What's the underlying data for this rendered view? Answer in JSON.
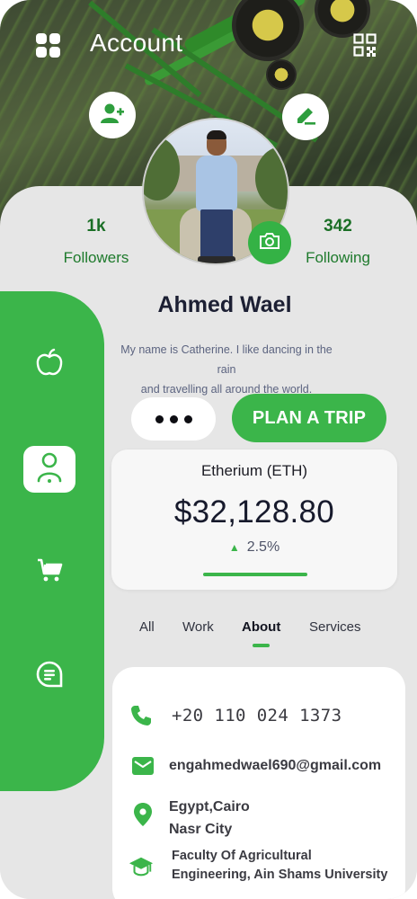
{
  "header": {
    "title": "Account",
    "menu_icon": "grid-icon",
    "qr_icon": "qr-code-icon"
  },
  "profile": {
    "name": "Ahmed Wael",
    "bio_line1": "My name is Catherine. I like dancing in the rain",
    "bio_line2": "and travelling all around the world.",
    "followers_count": "1k",
    "followers_label": "Followers",
    "following_count": "342",
    "following_label": "Following"
  },
  "actions": {
    "plan_trip_label": "PLAN A TRIP",
    "more_icon": "more-dots-icon",
    "add_friend_icon": "add-user-icon",
    "edit_icon": "edit-pencil-icon",
    "camera_icon": "camera-icon"
  },
  "sidebar": {
    "items": [
      {
        "icon": "apple-icon",
        "active": false
      },
      {
        "icon": "user-icon",
        "active": true
      },
      {
        "icon": "cart-icon",
        "active": false
      },
      {
        "icon": "chat-icon",
        "active": false
      }
    ]
  },
  "crypto": {
    "title": "Etherium (ETH)",
    "price": "$32,128.80",
    "change": "2.5%",
    "change_direction": "up"
  },
  "tabs": [
    {
      "label": "All",
      "active": false
    },
    {
      "label": "Work",
      "active": false
    },
    {
      "label": "About",
      "active": true
    },
    {
      "label": "Services",
      "active": false
    }
  ],
  "contact": {
    "phone": "+20 110 024 1373",
    "email": "engahmedwael690@gmail.com",
    "location_line1": "Egypt,Cairo",
    "location_line2": "Nasr City",
    "education_line1": "Faculty Of Agricultural",
    "education_line2": "Engineering, Ain Shams University"
  },
  "colors": {
    "accent": "#3bb54a",
    "dark_text": "#1c1f33",
    "background": "#e6e6e6"
  }
}
